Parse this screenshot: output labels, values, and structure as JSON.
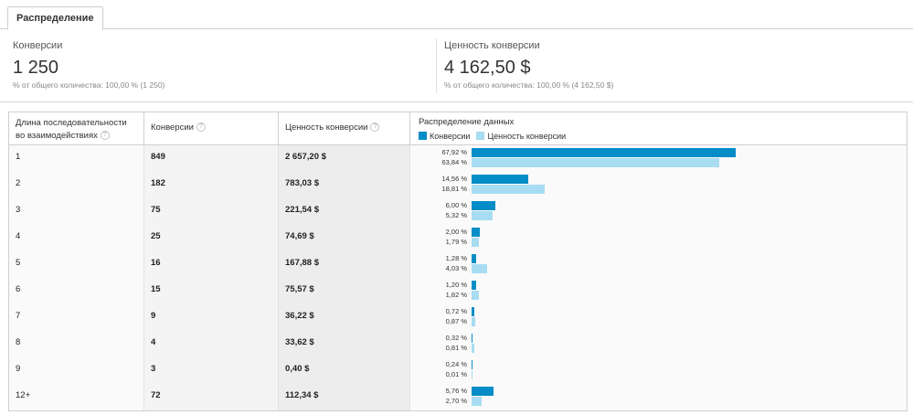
{
  "tab": {
    "label": "Распределение"
  },
  "summary": {
    "conversions": {
      "label": "Конверсии",
      "value": "1 250",
      "sub": "% от общего количества: 100,00 % (1 250)"
    },
    "value": {
      "label": "Ценность конверсии",
      "value": "4 162,50 $",
      "sub": "% от общего количества: 100,00 % (4 162,50 $)"
    }
  },
  "table": {
    "headers": {
      "path_length": "Длина последовательности во взаимодействиях",
      "conversions": "Конверсии",
      "value": "Ценность конверсии",
      "distribution": "Распределение данных"
    },
    "help_glyph": "?",
    "legend": {
      "conversions": "Конверсии",
      "value": "Ценность конверсии"
    },
    "colors": {
      "conversions": "#058dc7",
      "value": "#a8dcf2"
    },
    "rows": [
      {
        "length": "1",
        "conversions": "849",
        "value": "2 657,20 $",
        "conv_pct": "67,92 %",
        "value_pct": "63,84 %",
        "conv_frac": 0.6792,
        "value_frac": 0.6384
      },
      {
        "length": "2",
        "conversions": "182",
        "value": "783,03 $",
        "conv_pct": "14,56 %",
        "value_pct": "18,81 %",
        "conv_frac": 0.1456,
        "value_frac": 0.1881
      },
      {
        "length": "3",
        "conversions": "75",
        "value": "221,54 $",
        "conv_pct": "6,00 %",
        "value_pct": "5,32 %",
        "conv_frac": 0.06,
        "value_frac": 0.0532
      },
      {
        "length": "4",
        "conversions": "25",
        "value": "74,69 $",
        "conv_pct": "2,00 %",
        "value_pct": "1,79 %",
        "conv_frac": 0.02,
        "value_frac": 0.0179
      },
      {
        "length": "5",
        "conversions": "16",
        "value": "167,88 $",
        "conv_pct": "1,28 %",
        "value_pct": "4,03 %",
        "conv_frac": 0.0128,
        "value_frac": 0.0403
      },
      {
        "length": "6",
        "conversions": "15",
        "value": "75,57 $",
        "conv_pct": "1,20 %",
        "value_pct": "1,82 %",
        "conv_frac": 0.012,
        "value_frac": 0.0182
      },
      {
        "length": "7",
        "conversions": "9",
        "value": "36,22 $",
        "conv_pct": "0,72 %",
        "value_pct": "0,87 %",
        "conv_frac": 0.0072,
        "value_frac": 0.0087
      },
      {
        "length": "8",
        "conversions": "4",
        "value": "33,62 $",
        "conv_pct": "0,32 %",
        "value_pct": "0,81 %",
        "conv_frac": 0.0032,
        "value_frac": 0.0081
      },
      {
        "length": "9",
        "conversions": "3",
        "value": "0,40 $",
        "conv_pct": "0,24 %",
        "value_pct": "0,01 %",
        "conv_frac": 0.0024,
        "value_frac": 0.0001
      },
      {
        "length": "12+",
        "conversions": "72",
        "value": "112,34 $",
        "conv_pct": "5,76 %",
        "value_pct": "2,70 %",
        "conv_frac": 0.0576,
        "value_frac": 0.027
      }
    ]
  }
}
